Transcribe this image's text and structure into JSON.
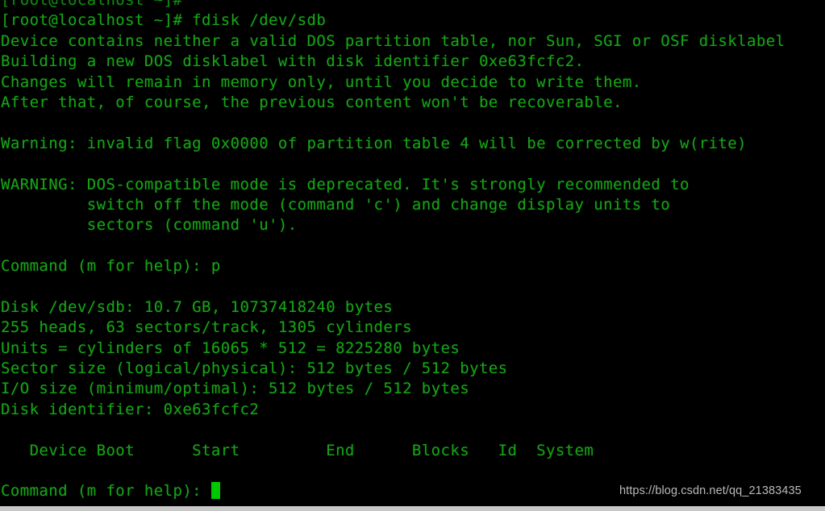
{
  "terminal": {
    "colors": {
      "background": "#000000",
      "foreground": "#17a317",
      "cursor": "#00c800",
      "watermark": "#b9b9b9",
      "bottom_strip": "#c8c8c8"
    },
    "lines": [
      "[root@localhost ~]#",
      "[root@localhost ~]# fdisk /dev/sdb",
      "Device contains neither a valid DOS partition table, nor Sun, SGI or OSF disklabel",
      "Building a new DOS disklabel with disk identifier 0xe63fcfc2.",
      "Changes will remain in memory only, until you decide to write them.",
      "After that, of course, the previous content won't be recoverable.",
      "",
      "Warning: invalid flag 0x0000 of partition table 4 will be corrected by w(rite)",
      "",
      "WARNING: DOS-compatible mode is deprecated. It's strongly recommended to",
      "         switch off the mode (command 'c') and change display units to",
      "         sectors (command 'u').",
      "",
      "Command (m for help): p",
      "",
      "Disk /dev/sdb: 10.7 GB, 10737418240 bytes",
      "255 heads, 63 sectors/track, 1305 cylinders",
      "Units = cylinders of 16065 * 512 = 8225280 bytes",
      "Sector size (logical/physical): 512 bytes / 512 bytes",
      "I/O size (minimum/optimal): 512 bytes / 512 bytes",
      "Disk identifier: 0xe63fcfc2",
      "",
      "   Device Boot      Start         End      Blocks   Id  System",
      ""
    ],
    "prompt": {
      "text": "Command (m for help): ",
      "cursor": "block-cursor"
    },
    "command_entered": "fdisk /dev/sdb",
    "shell_prompt": "[root@localhost ~]#",
    "disk_info": {
      "device": "/dev/sdb",
      "size_human": "10.7 GB",
      "size_bytes": "10737418240 bytes",
      "heads": "255",
      "sectors_per_track": "63",
      "cylinders": "1305",
      "units": "cylinders of 16065 * 512 = 8225280 bytes",
      "sector_size_logical": "512 bytes",
      "sector_size_physical": "512 bytes",
      "io_size_minimum": "512 bytes",
      "io_size_optimal": "512 bytes",
      "disk_identifier": "0xe63fcfc2"
    },
    "partition_table_headers": [
      "Device Boot",
      "Start",
      "End",
      "Blocks",
      "Id",
      "System"
    ]
  },
  "watermark": {
    "text": "https://blog.csdn.net/qq_21383435"
  }
}
